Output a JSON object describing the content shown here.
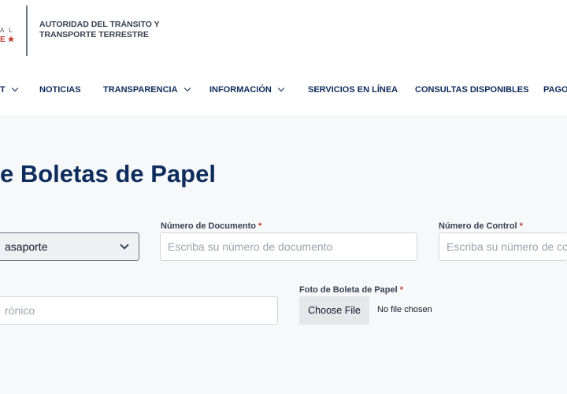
{
  "header": {
    "logo_fragment_line1": "A L",
    "logo_fragment_line2": "E ★",
    "org_name_line1": "AUTORIDAD DEL TRÁNSITO Y",
    "org_name_line2": "TRANSPORTE TERRESTRE"
  },
  "nav": {
    "items": [
      {
        "label": "T",
        "has_dropdown": true
      },
      {
        "label": "NOTICIAS",
        "has_dropdown": false
      },
      {
        "label": "TRANSPARENCIA",
        "has_dropdown": true
      },
      {
        "label": "INFORMACIÓN",
        "has_dropdown": true
      },
      {
        "label": "SERVICIOS EN LÍNEA",
        "has_dropdown": false
      },
      {
        "label": "CONSULTAS DISPONIBLES",
        "has_dropdown": false
      },
      {
        "label": "PAGOS",
        "has_dropdown": false
      }
    ]
  },
  "main": {
    "title": "e Boletas de Papel",
    "document_type": {
      "selected": "asaporte"
    },
    "document_number": {
      "label": "Número de Documento",
      "required_mark": "*",
      "placeholder": "Escriba su número de documento"
    },
    "control_number": {
      "label": "Número de Control",
      "required_mark": "*",
      "placeholder": "Escriba su número de co"
    },
    "email": {
      "placeholder": "rónico"
    },
    "photo": {
      "label": "Foto de Boleta de Papel",
      "required_mark": "*",
      "button_label": "Choose File",
      "status": "No file chosen"
    }
  },
  "colors": {
    "brand_navy": "#0d2c5c",
    "required_red": "#c0392b",
    "page_background": "#f7f8fa"
  }
}
